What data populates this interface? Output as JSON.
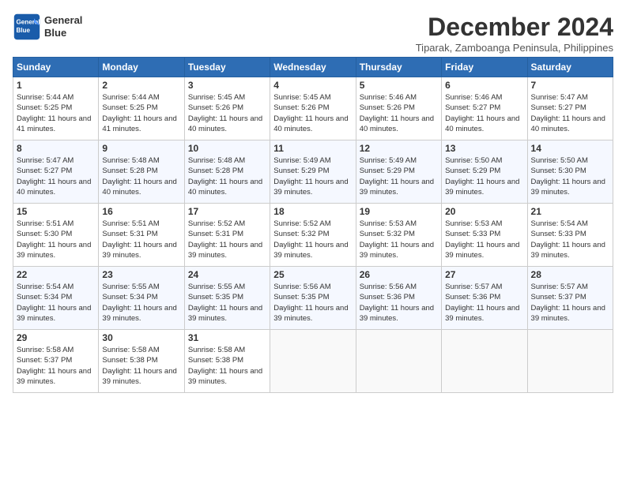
{
  "header": {
    "logo_line1": "General",
    "logo_line2": "Blue",
    "month_year": "December 2024",
    "location": "Tiparak, Zamboanga Peninsula, Philippines"
  },
  "days_of_week": [
    "Sunday",
    "Monday",
    "Tuesday",
    "Wednesday",
    "Thursday",
    "Friday",
    "Saturday"
  ],
  "weeks": [
    [
      {
        "day": 1,
        "sunrise": "5:44 AM",
        "sunset": "5:25 PM",
        "daylight": "11 hours and 41 minutes."
      },
      {
        "day": 2,
        "sunrise": "5:44 AM",
        "sunset": "5:25 PM",
        "daylight": "11 hours and 41 minutes."
      },
      {
        "day": 3,
        "sunrise": "5:45 AM",
        "sunset": "5:26 PM",
        "daylight": "11 hours and 40 minutes."
      },
      {
        "day": 4,
        "sunrise": "5:45 AM",
        "sunset": "5:26 PM",
        "daylight": "11 hours and 40 minutes."
      },
      {
        "day": 5,
        "sunrise": "5:46 AM",
        "sunset": "5:26 PM",
        "daylight": "11 hours and 40 minutes."
      },
      {
        "day": 6,
        "sunrise": "5:46 AM",
        "sunset": "5:27 PM",
        "daylight": "11 hours and 40 minutes."
      },
      {
        "day": 7,
        "sunrise": "5:47 AM",
        "sunset": "5:27 PM",
        "daylight": "11 hours and 40 minutes."
      }
    ],
    [
      {
        "day": 8,
        "sunrise": "5:47 AM",
        "sunset": "5:27 PM",
        "daylight": "11 hours and 40 minutes."
      },
      {
        "day": 9,
        "sunrise": "5:48 AM",
        "sunset": "5:28 PM",
        "daylight": "11 hours and 40 minutes."
      },
      {
        "day": 10,
        "sunrise": "5:48 AM",
        "sunset": "5:28 PM",
        "daylight": "11 hours and 40 minutes."
      },
      {
        "day": 11,
        "sunrise": "5:49 AM",
        "sunset": "5:29 PM",
        "daylight": "11 hours and 39 minutes."
      },
      {
        "day": 12,
        "sunrise": "5:49 AM",
        "sunset": "5:29 PM",
        "daylight": "11 hours and 39 minutes."
      },
      {
        "day": 13,
        "sunrise": "5:50 AM",
        "sunset": "5:29 PM",
        "daylight": "11 hours and 39 minutes."
      },
      {
        "day": 14,
        "sunrise": "5:50 AM",
        "sunset": "5:30 PM",
        "daylight": "11 hours and 39 minutes."
      }
    ],
    [
      {
        "day": 15,
        "sunrise": "5:51 AM",
        "sunset": "5:30 PM",
        "daylight": "11 hours and 39 minutes."
      },
      {
        "day": 16,
        "sunrise": "5:51 AM",
        "sunset": "5:31 PM",
        "daylight": "11 hours and 39 minutes."
      },
      {
        "day": 17,
        "sunrise": "5:52 AM",
        "sunset": "5:31 PM",
        "daylight": "11 hours and 39 minutes."
      },
      {
        "day": 18,
        "sunrise": "5:52 AM",
        "sunset": "5:32 PM",
        "daylight": "11 hours and 39 minutes."
      },
      {
        "day": 19,
        "sunrise": "5:53 AM",
        "sunset": "5:32 PM",
        "daylight": "11 hours and 39 minutes."
      },
      {
        "day": 20,
        "sunrise": "5:53 AM",
        "sunset": "5:33 PM",
        "daylight": "11 hours and 39 minutes."
      },
      {
        "day": 21,
        "sunrise": "5:54 AM",
        "sunset": "5:33 PM",
        "daylight": "11 hours and 39 minutes."
      }
    ],
    [
      {
        "day": 22,
        "sunrise": "5:54 AM",
        "sunset": "5:34 PM",
        "daylight": "11 hours and 39 minutes."
      },
      {
        "day": 23,
        "sunrise": "5:55 AM",
        "sunset": "5:34 PM",
        "daylight": "11 hours and 39 minutes."
      },
      {
        "day": 24,
        "sunrise": "5:55 AM",
        "sunset": "5:35 PM",
        "daylight": "11 hours and 39 minutes."
      },
      {
        "day": 25,
        "sunrise": "5:56 AM",
        "sunset": "5:35 PM",
        "daylight": "11 hours and 39 minutes."
      },
      {
        "day": 26,
        "sunrise": "5:56 AM",
        "sunset": "5:36 PM",
        "daylight": "11 hours and 39 minutes."
      },
      {
        "day": 27,
        "sunrise": "5:57 AM",
        "sunset": "5:36 PM",
        "daylight": "11 hours and 39 minutes."
      },
      {
        "day": 28,
        "sunrise": "5:57 AM",
        "sunset": "5:37 PM",
        "daylight": "11 hours and 39 minutes."
      }
    ],
    [
      {
        "day": 29,
        "sunrise": "5:58 AM",
        "sunset": "5:37 PM",
        "daylight": "11 hours and 39 minutes."
      },
      {
        "day": 30,
        "sunrise": "5:58 AM",
        "sunset": "5:38 PM",
        "daylight": "11 hours and 39 minutes."
      },
      {
        "day": 31,
        "sunrise": "5:58 AM",
        "sunset": "5:38 PM",
        "daylight": "11 hours and 39 minutes."
      },
      null,
      null,
      null,
      null
    ]
  ]
}
